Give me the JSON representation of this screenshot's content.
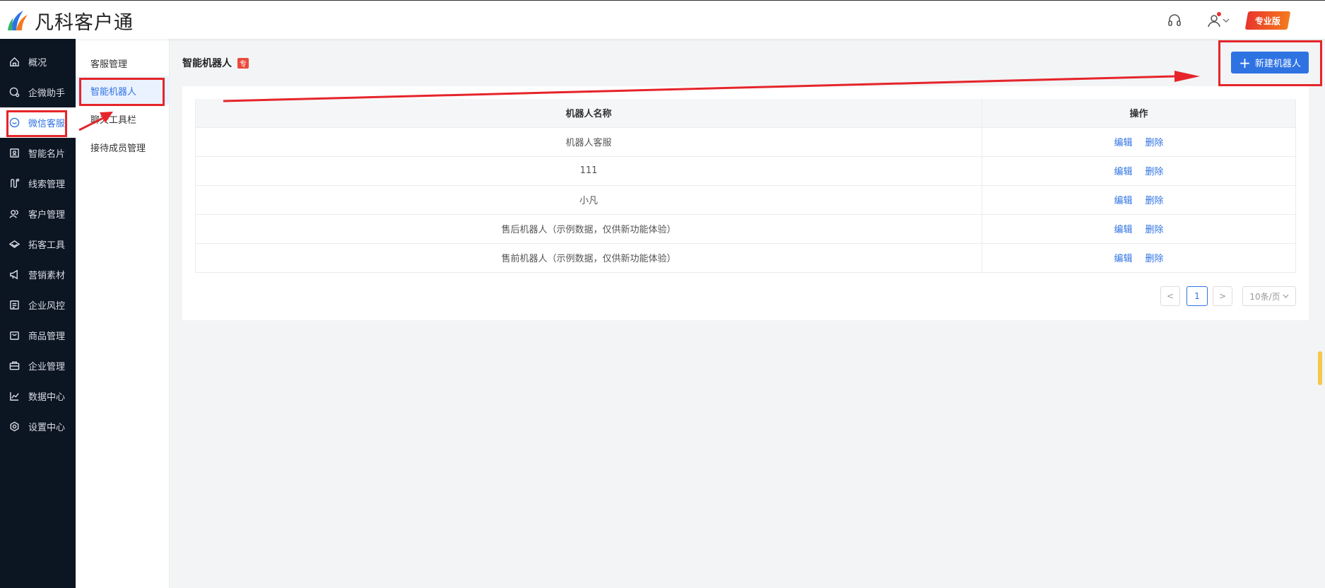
{
  "header": {
    "logo_text": "凡科客户通",
    "pro_badge": "专业版",
    "icons": [
      "headset-icon",
      "user-icon",
      "chevron-down-icon"
    ]
  },
  "sidebar": {
    "items": [
      {
        "label": "概况",
        "icon": "home-icon"
      },
      {
        "label": "企微助手",
        "icon": "chat-icon"
      },
      {
        "label": "微信客服",
        "icon": "wechat-service-icon",
        "active": true
      },
      {
        "label": "智能名片",
        "icon": "card-icon"
      },
      {
        "label": "线索管理",
        "icon": "clue-icon"
      },
      {
        "label": "客户管理",
        "icon": "customers-icon"
      },
      {
        "label": "拓客工具",
        "icon": "tools-icon"
      },
      {
        "label": "营销素材",
        "icon": "megaphone-icon"
      },
      {
        "label": "企业风控",
        "icon": "risk-icon"
      },
      {
        "label": "商品管理",
        "icon": "bag-icon"
      },
      {
        "label": "企业管理",
        "icon": "briefcase-icon"
      },
      {
        "label": "数据中心",
        "icon": "chart-icon"
      },
      {
        "label": "设置中心",
        "icon": "settings-icon"
      }
    ]
  },
  "subnav": {
    "items": [
      {
        "label": "客服管理"
      },
      {
        "label": "智能机器人",
        "active": true
      },
      {
        "label": "聊天工具栏"
      },
      {
        "label": "接待成员管理"
      }
    ]
  },
  "main": {
    "title": "智能机器人",
    "title_badge": "专",
    "new_button": "新建机器人",
    "table": {
      "headers": [
        "机器人名称",
        "操作"
      ],
      "rows": [
        {
          "name": "机器人客服",
          "edit": "编辑",
          "delete": "删除"
        },
        {
          "name": "111",
          "edit": "编辑",
          "delete": "删除"
        },
        {
          "name": "小凡",
          "edit": "编辑",
          "delete": "删除"
        },
        {
          "name": "售后机器人（示例数据，仅供新功能体验）",
          "edit": "编辑",
          "delete": "删除"
        },
        {
          "name": "售前机器人（示例数据，仅供新功能体验）",
          "edit": "编辑",
          "delete": "删除"
        }
      ]
    },
    "pagination": {
      "prev": "<",
      "current": "1",
      "next": ">",
      "page_size": "10条/页"
    }
  },
  "colors": {
    "accent": "#2f73e3",
    "sidebar_bg": "#0c1522",
    "annotation": "#e5252a"
  }
}
